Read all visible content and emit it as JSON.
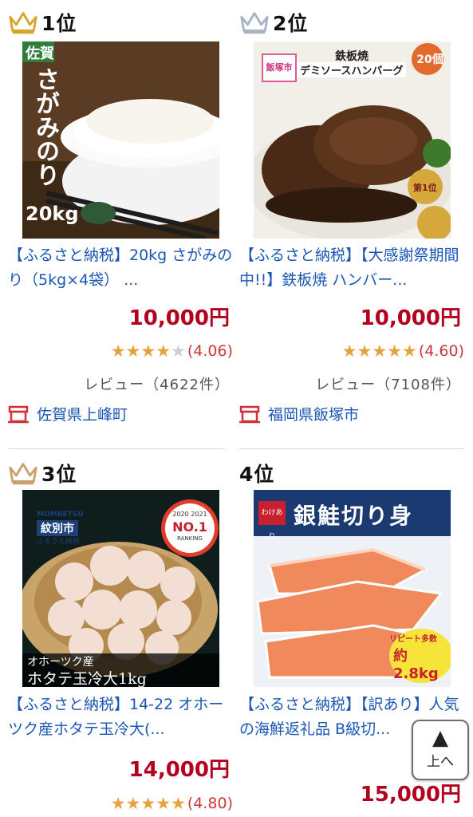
{
  "items": [
    {
      "rank": "1位",
      "crown_color": "#d6a62a",
      "title": "【ふるさと納税】20kg さがみのり（5kg×4袋） ...",
      "price": "10,000円",
      "stars": "★★★★",
      "stars_empty": "★",
      "rating": "(4.06)",
      "reviews": "レビュー（4622件）",
      "location": "佐賀県上峰町",
      "image": {
        "tag": "佐賀",
        "name": "さがみのり",
        "weight": "20kg"
      }
    },
    {
      "rank": "2位",
      "crown_color": "#a8b4c4",
      "title": "【ふるさと納税】【大感謝祭期間中!!】鉄板焼 ハンバー...",
      "price": "10,000円",
      "stars": "★★★★",
      "stars_empty": "★",
      "rating": "(4.60)",
      "reviews": "レビュー（7108件）",
      "location": "福岡県飯塚市",
      "image": {
        "city": "飯塚市",
        "headline1": "鉄板焼",
        "headline2": "デミソースハンバーグ",
        "count": "20個",
        "badge": "第1位"
      }
    },
    {
      "rank": "3位",
      "crown_color": "#c9a26a",
      "title": "【ふるさと納税】14-22 オホーツク産ホタテ玉冷大(...",
      "price": "14,000円",
      "stars": "★★★★",
      "stars_empty": "★",
      "rating": "(4.80)",
      "image": {
        "brand": "MOMBETSU",
        "city": "紋別市",
        "sub": "ふるさと納税",
        "years": "2020 2021",
        "award": "NO.1",
        "award_sub": "RANKING",
        "caption1": "オホーツク産",
        "caption2": "ホタテ玉冷大1kg"
      }
    },
    {
      "rank": "4位",
      "title": "【ふるさと納税】【訳あり】人気の海鮮返礼品 B級切...",
      "price": "15,000円",
      "image": {
        "tag": "わけあり",
        "headline": "銀鮭切り身",
        "repeat": "リピート多数",
        "weight": "約2.8kg"
      }
    }
  ],
  "back_to_top": {
    "arrow": "▲",
    "label": "上へ"
  }
}
